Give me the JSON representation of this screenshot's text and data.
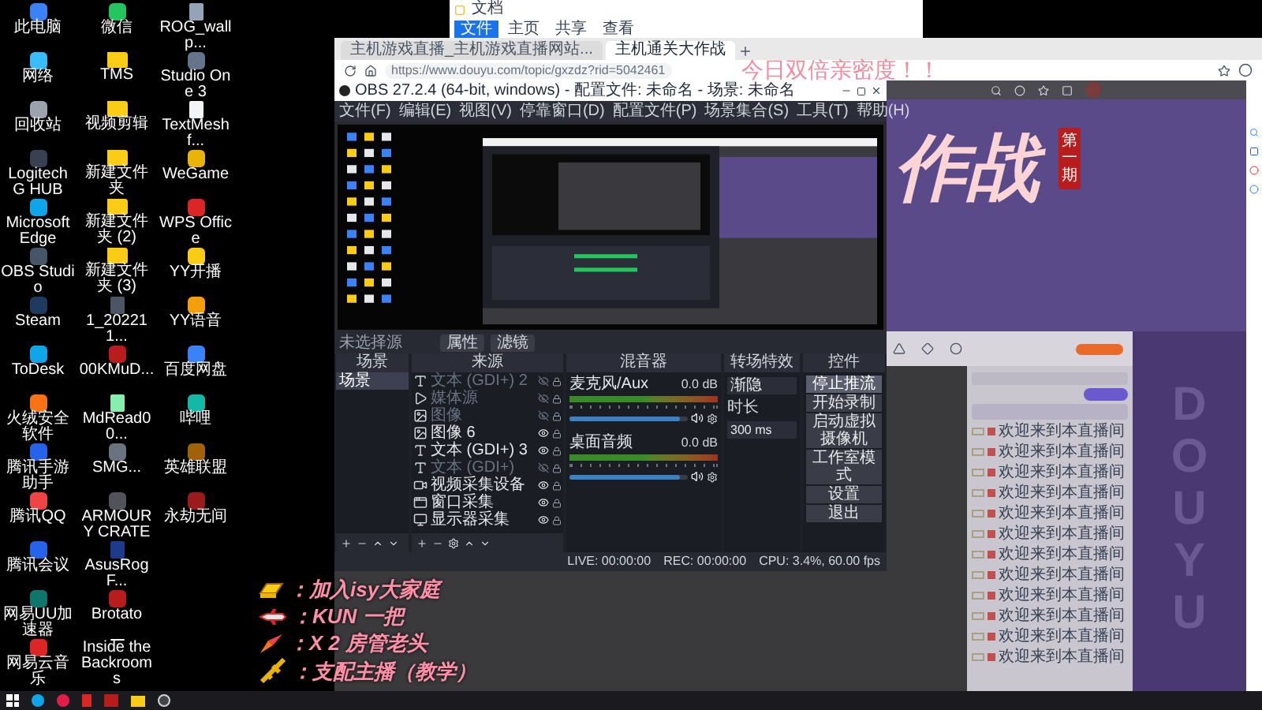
{
  "desktop": {
    "icons": [
      {
        "label": "此电脑",
        "kind": "app",
        "color": "#3b82f6"
      },
      {
        "label": "网络",
        "kind": "app",
        "color": "#38bdf8"
      },
      {
        "label": "回收站",
        "kind": "app",
        "color": "#9ca3af"
      },
      {
        "label": "Logitech G HUB",
        "kind": "app",
        "color": "#374151"
      },
      {
        "label": "Microsoft Edge",
        "kind": "app",
        "color": "#0ea5e9"
      },
      {
        "label": "OBS Studio",
        "kind": "app",
        "color": "#475569"
      },
      {
        "label": "Steam",
        "kind": "app",
        "color": "#1e3a5f"
      },
      {
        "label": "ToDesk",
        "kind": "app",
        "color": "#0ea5e9"
      },
      {
        "label": "火绒安全软件",
        "kind": "app",
        "color": "#f97316"
      },
      {
        "label": "腾讯手游助手",
        "kind": "app",
        "color": "#2563eb"
      },
      {
        "label": "腾讯QQ",
        "kind": "app",
        "color": "#ef4444"
      },
      {
        "label": "腾讯会议",
        "kind": "app",
        "color": "#2563eb"
      },
      {
        "label": "网易UU加速器",
        "kind": "app",
        "color": "#0f766e"
      },
      {
        "label": "网易云音乐",
        "kind": "app",
        "color": "#dc2626"
      },
      {
        "label": "微信",
        "kind": "app",
        "color": "#22c55e"
      },
      {
        "label": "TMS",
        "kind": "folder",
        "color": "#facc15"
      },
      {
        "label": "视频剪辑",
        "kind": "folder",
        "color": "#facc15"
      },
      {
        "label": "新建文件夹",
        "kind": "folder",
        "color": "#facc15"
      },
      {
        "label": "新建文件夹 (2)",
        "kind": "folder",
        "color": "#facc15"
      },
      {
        "label": "新建文件夹 (3)",
        "kind": "folder",
        "color": "#facc15"
      },
      {
        "label": "1_202211...",
        "kind": "file",
        "color": "#4b5563"
      },
      {
        "label": "00KMuD...",
        "kind": "app",
        "color": "#b91c1c"
      },
      {
        "label": "MdRead00...",
        "kind": "file",
        "color": "#86efac"
      },
      {
        "label": "SMG...",
        "kind": "app",
        "color": "#6b7280"
      },
      {
        "label": "ARMOURY CRATE",
        "kind": "app",
        "color": "#52525b"
      },
      {
        "label": "AsusRogF...",
        "kind": "file",
        "color": "#1e3a8a"
      },
      {
        "label": "Brotato",
        "kind": "app",
        "color": "#b91c1c"
      },
      {
        "label": "Inside the Backrooms",
        "kind": "file",
        "color": "#f3f4f6"
      },
      {
        "label": "ROG_wallp...",
        "kind": "file",
        "color": "#94a3b8"
      },
      {
        "label": "Studio One 3",
        "kind": "app",
        "color": "#64748b"
      },
      {
        "label": "TextMeshf...",
        "kind": "file",
        "color": "#f3f4f6"
      },
      {
        "label": "WeGame",
        "kind": "app",
        "color": "#eab308"
      },
      {
        "label": "WPS Office",
        "kind": "app",
        "color": "#dc2626"
      },
      {
        "label": "YY开播",
        "kind": "app",
        "color": "#facc15"
      },
      {
        "label": "YY语音",
        "kind": "app",
        "color": "#f59e0b"
      },
      {
        "label": "百度网盘",
        "kind": "app",
        "color": "#3b82f6"
      },
      {
        "label": "哔哩",
        "kind": "app",
        "color": "#14b8a6"
      },
      {
        "label": "英雄联盟",
        "kind": "app",
        "color": "#a16207"
      },
      {
        "label": "永劫无间",
        "kind": "app",
        "color": "#991b1b"
      }
    ]
  },
  "file_explorer": {
    "title": "文档",
    "ribbon_tabs": [
      {
        "label": "文件",
        "selected": true
      },
      {
        "label": "主页",
        "selected": false
      },
      {
        "label": "共享",
        "selected": false
      },
      {
        "label": "查看",
        "selected": false
      }
    ]
  },
  "browser": {
    "tabs": [
      {
        "label": "主机游戏直播_主机游戏直播网站...",
        "selected": false
      },
      {
        "label": "主机通关大作战",
        "selected": true
      }
    ],
    "url": "https://www.douyu.com/topic/gxzdz?rid=5042461"
  },
  "douyu": {
    "banner_title": "作战",
    "issue_badge": "第一期",
    "watermark": "DOUYU",
    "chat_messages": [
      {
        "text": "欢迎来到本直播间"
      },
      {
        "text": "欢迎来到本直播间"
      },
      {
        "text": "欢迎来到本直播间"
      },
      {
        "text": "欢迎来到本直播间"
      },
      {
        "text": "欢迎来到本直播间"
      },
      {
        "text": "欢迎来到本直播间"
      },
      {
        "text": "欢迎来到本直播间"
      },
      {
        "text": "欢迎来到本直播间"
      },
      {
        "text": "欢迎来到本直播间"
      },
      {
        "text": "欢迎来到本直播间"
      },
      {
        "text": "欢迎来到本直播间"
      },
      {
        "text": "欢迎来到本直播间"
      }
    ]
  },
  "stream_overlay": {
    "banner": "今日双倍亲密度！！",
    "gifts": [
      {
        "kind": "gold",
        "text": "：加入isy大家庭"
      },
      {
        "kind": "plane",
        "text": "：KUN 一把"
      },
      {
        "kind": "rocket",
        "text": "：X 2 房管老头"
      },
      {
        "kind": "mech",
        "text": "：支配主播（教学）"
      }
    ]
  },
  "obs": {
    "title": "OBS 27.2.4 (64-bit, windows) - 配置文件: 未命名 - 场景: 未命名",
    "menu": [
      "文件(F)",
      "编辑(E)",
      "视图(V)",
      "停靠窗口(D)",
      "配置文件(P)",
      "场景集合(S)",
      "工具(T)",
      "帮助(H)"
    ],
    "source_toolbar": {
      "label": "未选择源",
      "buttons": [
        "属性",
        "滤镜"
      ]
    },
    "scenes": {
      "title": "场景",
      "items": [
        {
          "label": "场景",
          "selected": true
        }
      ]
    },
    "sources": {
      "title": "来源",
      "items": [
        {
          "kind": "text",
          "label": "文本 (GDI+) 2",
          "visible": false
        },
        {
          "kind": "media",
          "label": "媒体源",
          "visible": false
        },
        {
          "kind": "image",
          "label": "图像",
          "visible": false
        },
        {
          "kind": "image",
          "label": "图像 6",
          "visible": true
        },
        {
          "kind": "text",
          "label": "文本 (GDI+) 3",
          "visible": true
        },
        {
          "kind": "text",
          "label": "文本 (GDI+)",
          "visible": false
        },
        {
          "kind": "video",
          "label": "视频采集设备",
          "visible": true
        },
        {
          "kind": "window",
          "label": "窗口采集",
          "visible": true
        },
        {
          "kind": "display",
          "label": "显示器采集",
          "visible": true
        }
      ]
    },
    "mixer": {
      "title": "混音器",
      "channels": [
        {
          "name": "麦克风/Aux",
          "reading": "0.0 dB",
          "level": 0.93
        },
        {
          "name": "桌面音频",
          "reading": "0.0 dB",
          "level": 0.93
        }
      ]
    },
    "transitions": {
      "title": "转场特效",
      "type": "渐隐",
      "duration_label": "时长",
      "duration": "300 ms"
    },
    "controls": {
      "title": "控件",
      "buttons": [
        {
          "label": "停止推流",
          "active": true
        },
        {
          "label": "开始录制",
          "active": false
        },
        {
          "label": "启动虚拟摄像机",
          "active": false
        },
        {
          "label": "工作室模式",
          "active": false
        },
        {
          "label": "设置",
          "active": false
        },
        {
          "label": "退出",
          "active": false
        }
      ]
    },
    "status": {
      "live": "LIVE: 00:00:00",
      "rec": "REC: 00:00:00",
      "cpu": "CPU: 3.4%, 60.00 fps"
    }
  }
}
